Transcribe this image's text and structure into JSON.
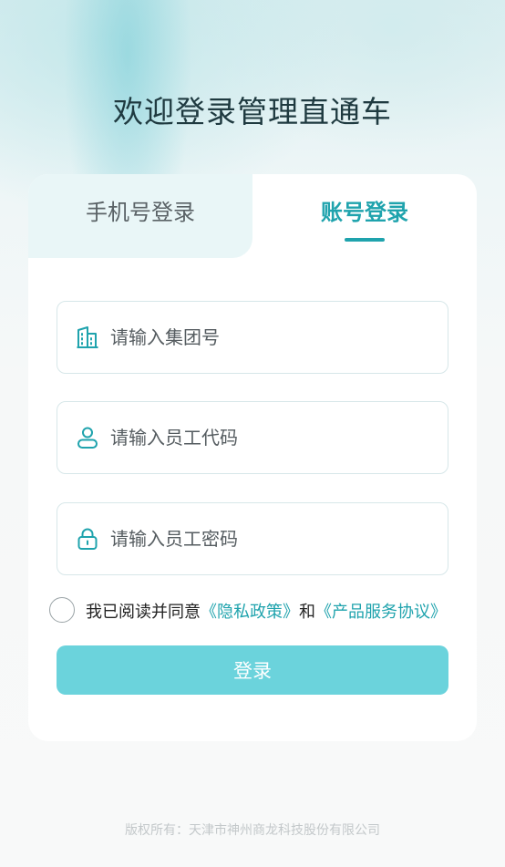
{
  "header": {
    "title": "欢迎登录管理直通车"
  },
  "tabs": {
    "phone_label": "手机号登录",
    "account_label": "账号登录",
    "active": "account"
  },
  "form": {
    "group_placeholder": "请输入集团号",
    "group_icon": "building-icon",
    "code_placeholder": "请输入员工代码",
    "code_icon": "user-icon",
    "password_placeholder": "请输入员工密码",
    "password_icon": "lock-icon"
  },
  "agreement": {
    "prefix": "我已阅读并同意",
    "privacy_link": "《隐私政策》",
    "joiner": "和",
    "service_link": "《产品服务协议》",
    "checked": false
  },
  "login_button": {
    "label": "登录"
  },
  "footer": {
    "copyright": "版权所有：天津市神州商龙科技股份有限公司"
  },
  "colors": {
    "accent": "#1fa3ad",
    "button": "#6bd3dc",
    "tab_inactive_bg": "#e9f6f7"
  }
}
